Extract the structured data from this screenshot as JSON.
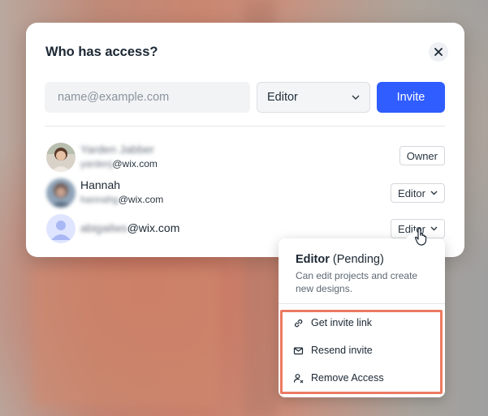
{
  "dialog": {
    "title": "Who has access?",
    "email_placeholder": "name@example.com",
    "role_value": "Editor",
    "invite_label": "Invite"
  },
  "members": [
    {
      "name": "Yarden Jabber",
      "email_local": "yardenj",
      "email_domain": "@wix.com",
      "role": "Owner"
    },
    {
      "name": "Hannah",
      "email_local": "hannahg",
      "email_domain": "@wix.com",
      "role": "Editor"
    },
    {
      "email_local": "abigailws",
      "email_domain": "@wix.com",
      "role": "Editor"
    }
  ],
  "role_menu": {
    "title_role": "Editor",
    "title_status": " (Pending)",
    "description": "Can edit projects and create new designs.",
    "items": [
      {
        "label": "Get invite link",
        "icon": "link-icon"
      },
      {
        "label": "Resend invite",
        "icon": "envelope-icon"
      },
      {
        "label": "Remove Access",
        "icon": "remove-user-icon"
      }
    ]
  },
  "colors": {
    "accent": "#2f5dff",
    "highlight": "#ec7a62"
  }
}
